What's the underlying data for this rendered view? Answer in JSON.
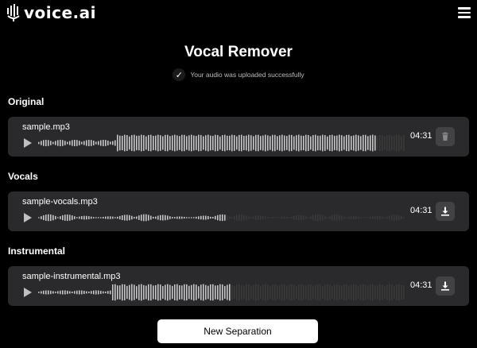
{
  "brand": {
    "name": "voice.ai",
    "logo_icon": "voice-ai-logo-icon"
  },
  "header": {
    "menu_icon": "hamburger-menu-icon"
  },
  "page": {
    "title": "Vocal Remover",
    "status_icon": "check-icon",
    "status_text": "Your audio was uploaded successfully"
  },
  "sections": [
    {
      "label": "Original",
      "file": "sample.mp3",
      "duration": "04:31",
      "action_icon": "trash-icon",
      "action": "delete"
    },
    {
      "label": "Vocals",
      "file": "sample-vocals.mp3",
      "duration": "04:31",
      "action_icon": "download-icon",
      "action": "download"
    },
    {
      "label": "Instrumental",
      "file": "sample-instrumental.mp3",
      "duration": "04:31",
      "action_icon": "download-icon",
      "action": "download"
    }
  ],
  "colors": {
    "background": "#000000",
    "card": "#2a2a2c",
    "wave_played": "#c8c8c8",
    "wave_unplayed": "#3a3a3a",
    "button_bg": "#ffffff"
  },
  "footer": {
    "new_separation_label": "New Separation"
  }
}
